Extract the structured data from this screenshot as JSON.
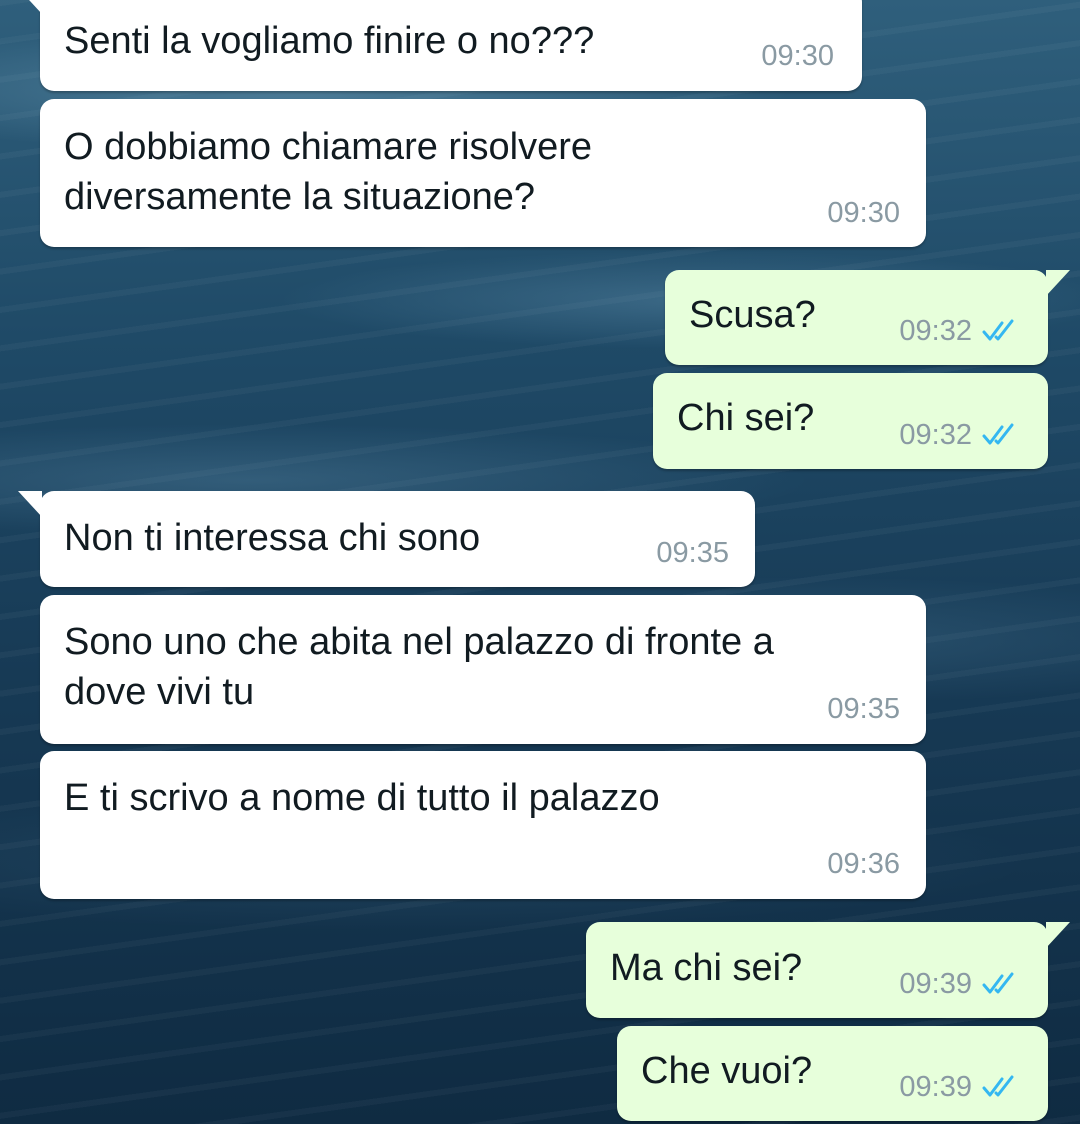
{
  "colors": {
    "incoming_bubble": "#ffffff",
    "outgoing_bubble": "#e7ffdb",
    "text": "#111b21",
    "timestamp": "#8a9aa3",
    "read_ticks": "#34b7f1"
  },
  "messages": [
    {
      "direction": "incoming",
      "text": "Senti la vogliamo finire o no???",
      "time": "09:30"
    },
    {
      "direction": "incoming",
      "text": "O dobbiamo chiamare risolvere\ndiversamente la situazione?",
      "time": "09:30"
    },
    {
      "direction": "outgoing",
      "text": "Scusa?",
      "time": "09:32",
      "status": "read-double-check-icon"
    },
    {
      "direction": "outgoing",
      "text": "Chi sei?",
      "time": "09:32",
      "status": "read-double-check-icon"
    },
    {
      "direction": "incoming",
      "text": "Non ti interessa chi sono",
      "time": "09:35"
    },
    {
      "direction": "incoming",
      "text": "Sono uno che abita nel palazzo di fronte a\ndove vivi tu",
      "time": "09:35"
    },
    {
      "direction": "incoming",
      "text": "E ti scrivo a nome di tutto il palazzo",
      "time": "09:36"
    },
    {
      "direction": "outgoing",
      "text": "Ma chi sei?",
      "time": "09:39",
      "status": "read-double-check-icon"
    },
    {
      "direction": "outgoing",
      "text": "Che vuoi?",
      "time": "09:39",
      "status": "read-double-check-icon"
    }
  ]
}
